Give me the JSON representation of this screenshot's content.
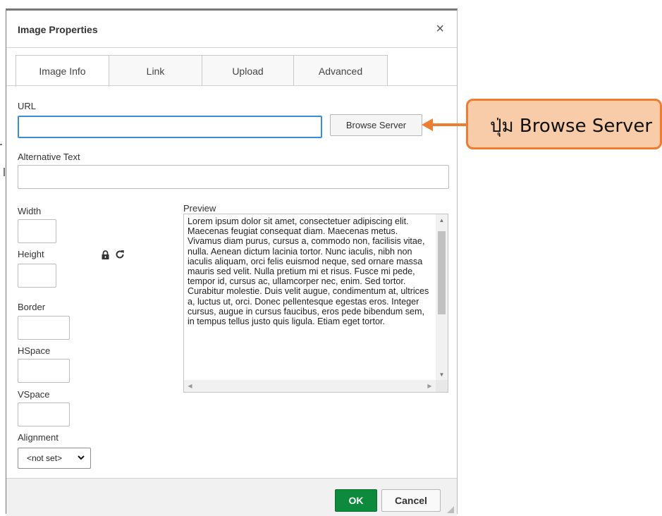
{
  "dialog": {
    "title": "Image Properties",
    "close_symbol": "×",
    "tabs": [
      {
        "label": "Image Info",
        "active": true
      },
      {
        "label": "Link",
        "active": false
      },
      {
        "label": "Upload",
        "active": false
      },
      {
        "label": "Advanced",
        "active": false
      }
    ],
    "url_label": "URL",
    "url_value": "",
    "browse_button": "Browse Server",
    "alt_label": "Alternative Text",
    "alt_value": "",
    "width_label": "Width",
    "height_label": "Height",
    "border_label": "Border",
    "hspace_label": "HSpace",
    "vspace_label": "VSpace",
    "alignment_label": "Alignment",
    "alignment_value": "<not set>",
    "preview_label": "Preview",
    "preview_text": "Lorem ipsum dolor sit amet, consectetuer adipiscing elit. Maecenas feugiat consequat diam. Maecenas metus. Vivamus diam purus, cursus a, commodo non, facilisis vitae, nulla. Aenean dictum lacinia tortor. Nunc iaculis, nibh non iaculis aliquam, orci felis euismod neque, sed ornare massa mauris sed velit. Nulla pretium mi et risus. Fusce mi pede, tempor id, cursus ac, ullamcorper nec, enim. Sed tortor. Curabitur molestie. Duis velit augue, condimentum at, ultrices a, luctus ut, orci. Donec pellentesque egestas eros. Integer cursus, augue in cursus faucibus, eros pede bibendum sem, in tempus tellus justo quis ligula. Etiam eget tortor.",
    "ok_button": "OK",
    "cancel_button": "Cancel",
    "icons": {
      "lock": "lock-icon",
      "reset": "reset-size-icon"
    }
  },
  "callout": {
    "text": "ปุ่ม Browse Server",
    "fill_color": "#f8cba9",
    "border_color": "#ed7d31"
  },
  "colors": {
    "ok_green": "#0e8a3d",
    "focus_blue": "#3a8ed8"
  }
}
